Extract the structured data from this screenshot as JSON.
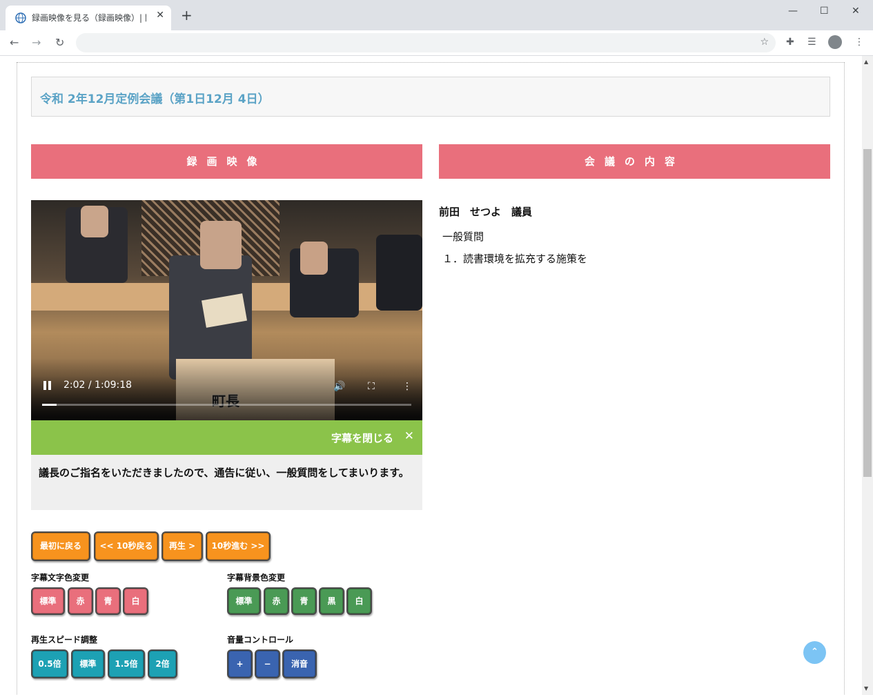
{
  "browser": {
    "tab_title": "録画映像を見る（録画映像）| 関",
    "tab_close": "✕",
    "new_tab": "+",
    "minimize": "—",
    "maximize": "☐",
    "close": "✕",
    "back": "←",
    "forward": "→",
    "reload": "↻",
    "bookmark_star": "☆",
    "extensions": "✚",
    "reading_list": "☰",
    "menu": "⋮",
    "url": ""
  },
  "page": {
    "meeting_title": "令和 2年12月定例会議（第1日12月 4日）",
    "video_header": "録画映像",
    "content_header": "会議の内容"
  },
  "video": {
    "current_time": "2:02",
    "duration": "1:09:18",
    "time_display": "2:02 / 1:09:18",
    "progress_fraction": 0.04,
    "overlay_text": "町長",
    "volume_icon": "🔊",
    "fullscreen_icon": "⛶",
    "more_icon": "⋮"
  },
  "caption": {
    "close_label": "字幕を閉じる",
    "close_x": "✕",
    "text": "議長のご指名をいただきましたので、通告に従い、一般質問をしてまいります。"
  },
  "meeting": {
    "speaker": "前田　せつよ　議員",
    "agenda_type": "一般質問",
    "agenda_item": "１．読書環境を拡充する施策を"
  },
  "controls": {
    "nav": [
      "最初に戻る",
      "<< 10秒戻る",
      "再生 >",
      "10秒進む >>"
    ],
    "text_color_label": "字幕文字色変更",
    "text_color": [
      "標準",
      "赤",
      "青",
      "白"
    ],
    "bg_color_label": "字幕背景色変更",
    "bg_color": [
      "標準",
      "赤",
      "青",
      "黒",
      "白"
    ],
    "speed_label": "再生スピード調整",
    "speed": [
      "0.5倍",
      "標準",
      "1.5倍",
      "2倍"
    ],
    "volume_label": "音量コントロール",
    "volume": [
      "+",
      "−",
      "消音"
    ]
  },
  "page_top": "⌃",
  "scroll": {
    "up": "▲",
    "down": "▼"
  }
}
